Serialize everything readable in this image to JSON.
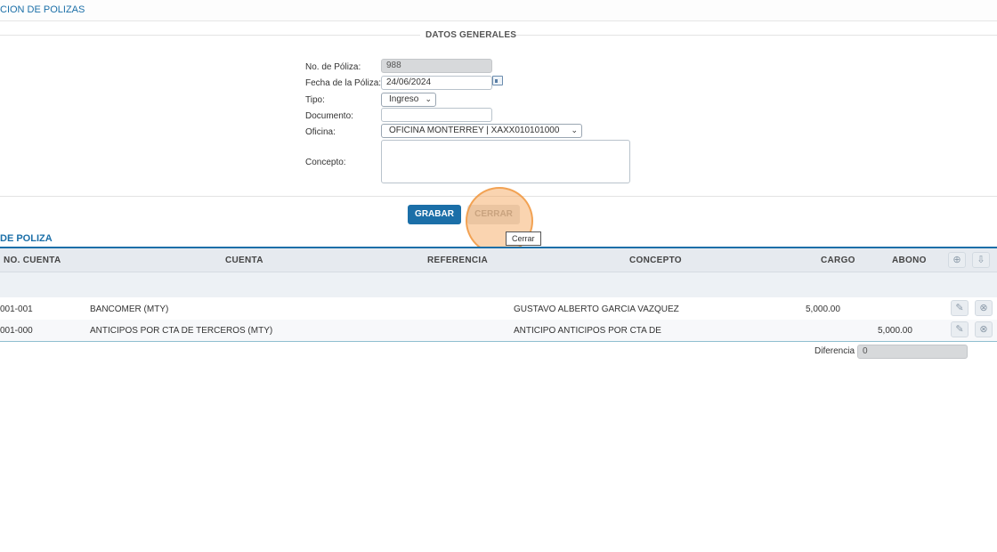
{
  "header": {
    "title": "CION DE POLIZAS"
  },
  "form": {
    "legend": "DATOS GENERALES",
    "poliza_label": "No. de Póliza:",
    "poliza_value": "988",
    "fecha_label": "Fecha de la Póliza:",
    "fecha_value": "24/06/2024",
    "tipo_label": "Tipo:",
    "tipo_value": "Ingreso",
    "documento_label": "Documento:",
    "documento_value": "",
    "oficina_label": "Oficina:",
    "oficina_value": "OFICINA MONTERREY | XAXX010101000",
    "concepto_label": "Concepto:",
    "concepto_value": ""
  },
  "actions": {
    "grabar": "GRABAR",
    "cerrar": "CERRAR",
    "tooltip": "Cerrar"
  },
  "detail": {
    "title": "DE POLIZA",
    "columns": {
      "no_cuenta": "NO. CUENTA",
      "cuenta": "CUENTA",
      "referencia": "REFERENCIA",
      "concepto": "CONCEPTO",
      "cargo": "CARGO",
      "abono": "ABONO"
    },
    "rows": [
      {
        "no_cuenta": "001-001",
        "cuenta": "BANCOMER (MTY)",
        "referencia": "",
        "concepto": "GUSTAVO ALBERTO GARCIA VAZQUEZ",
        "cargo": "5,000.00",
        "abono": ""
      },
      {
        "no_cuenta": "001-000",
        "cuenta": "ANTICIPOS POR CTA DE TERCEROS (MTY)",
        "referencia": "",
        "concepto": "ANTICIPO ANTICIPOS POR CTA DE",
        "cargo": "",
        "abono": "5,000.00"
      }
    ],
    "diferencia_label": "Diferencia",
    "diferencia_value": "0"
  },
  "icons": {
    "add": "plus-circle-icon",
    "export": "download-icon",
    "edit": "edit-icon",
    "delete": "close-circle-icon",
    "calendar": "calendar-icon"
  },
  "colors": {
    "accent": "#1b6fa8",
    "disabled_button": "#e4e4e4",
    "header_bg": "#e6eaef"
  }
}
